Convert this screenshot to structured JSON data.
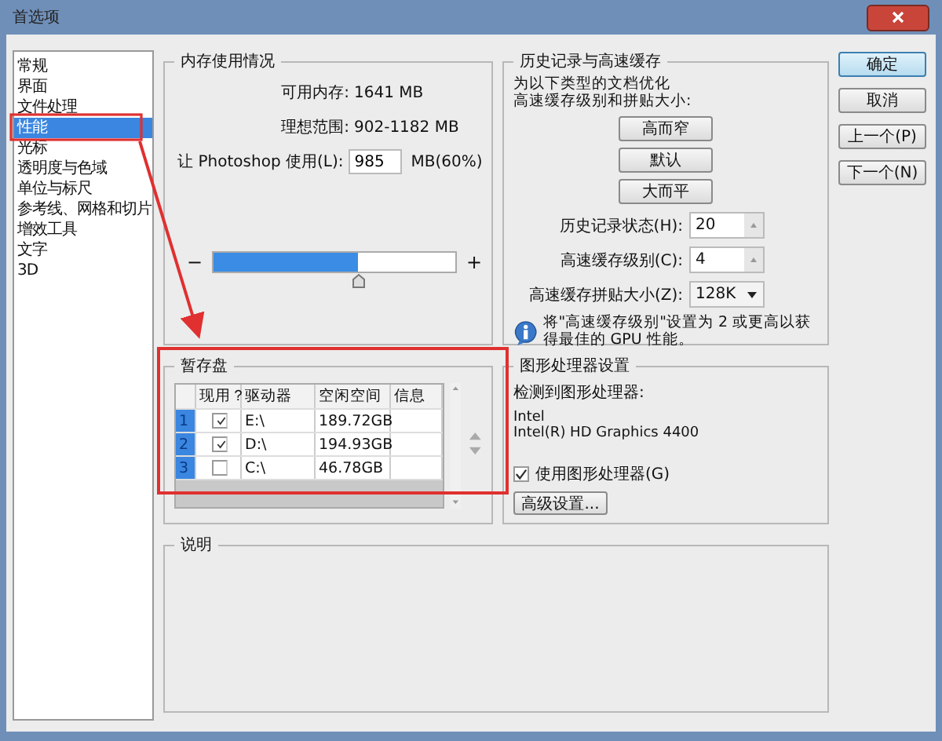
{
  "window": {
    "title": "首选项"
  },
  "sidebar": {
    "items": [
      {
        "label": "常规",
        "selected": false
      },
      {
        "label": "界面",
        "selected": false
      },
      {
        "label": "文件处理",
        "selected": false
      },
      {
        "label": "性能",
        "selected": true
      },
      {
        "label": "光标",
        "selected": false
      },
      {
        "label": "透明度与色域",
        "selected": false
      },
      {
        "label": "单位与标尺",
        "selected": false
      },
      {
        "label": "参考线、网格和切片",
        "selected": false
      },
      {
        "label": "增效工具",
        "selected": false
      },
      {
        "label": "文字",
        "selected": false
      },
      {
        "label": "3D",
        "selected": false
      }
    ]
  },
  "memory": {
    "title": "内存使用情况",
    "available_label": "可用内存:",
    "available": "1641 MB",
    "ideal_label": "理想范围:",
    "ideal": "902-1182 MB",
    "use_label": "让 Photoshop 使用(L):",
    "use_value": "985",
    "use_unit": "MB(60%)",
    "slider": {
      "minus": "−",
      "plus": "+",
      "level": 0.6
    }
  },
  "history": {
    "title": "历史记录与高速缓存",
    "intro": [
      "为以下类型的文档优化",
      "高速缓存级别和拼贴大小:"
    ],
    "presets": [
      "高而窄",
      "默认",
      "大而平"
    ],
    "fields": [
      {
        "kind": "spinner",
        "label": "历史记录状态(H):",
        "value": "20"
      },
      {
        "kind": "spinner",
        "label": "高速缓存级别(C):",
        "value": "4"
      },
      {
        "kind": "dropdown",
        "label": "高速缓存拼贴大小(Z):",
        "value": "128K"
      }
    ],
    "note": "将\"高速缓存级别\"设置为 2 或更高以获得最佳的 GPU 性能。"
  },
  "scratch": {
    "title": "暂存盘",
    "columns": [
      "现用？",
      "驱动器",
      "空闲空间",
      "信息"
    ],
    "rows": [
      {
        "index": "1",
        "checked": true,
        "drive": "E:\\",
        "free": "189.72GB"
      },
      {
        "index": "2",
        "checked": true,
        "drive": "D:\\",
        "free": "194.93GB"
      },
      {
        "index": "3",
        "checked": false,
        "drive": "C:\\",
        "free": "46.78GB"
      }
    ]
  },
  "gpu": {
    "title": "图形处理器设置",
    "detected_label": "检测到图形处理器:",
    "vendor": "Intel",
    "model": "Intel(R) HD Graphics 4400",
    "use_gpu": {
      "label": "使用图形处理器(G)",
      "checked": true
    },
    "advanced_button": "高级设置..."
  },
  "description": {
    "title": "说明"
  },
  "buttons": [
    {
      "label": "确定",
      "kind": "default"
    },
    {
      "label": "取消",
      "kind": "normal"
    },
    {
      "label": "上一个(P)",
      "kind": "normal"
    },
    {
      "label": "下一个(N)",
      "kind": "normal"
    }
  ]
}
